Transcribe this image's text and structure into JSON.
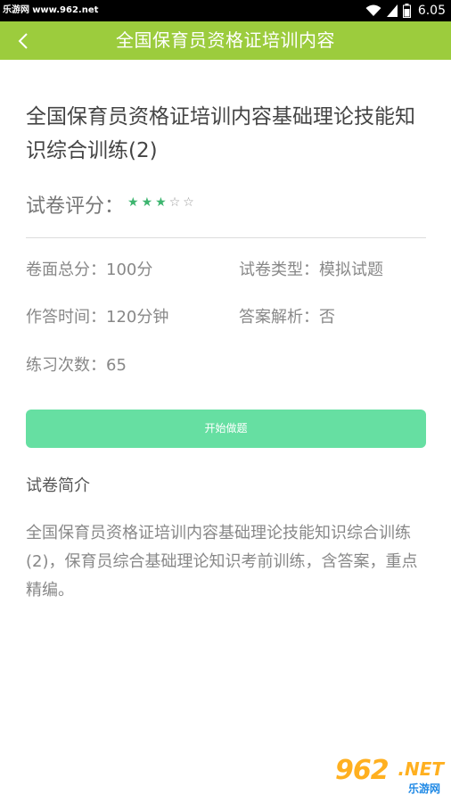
{
  "statusbar": {
    "watermark_site": "乐游网",
    "watermark_url": "www.962.net",
    "time": "6.05"
  },
  "appbar": {
    "title": "全国保育员资格证培训内容"
  },
  "exam": {
    "title": "全国保育员资格证培训内容基础理论技能知识综合训练(2)",
    "rating_label": "试卷评分：",
    "rating": 3,
    "rating_max": 5,
    "info": {
      "total_score": "卷面总分：100分",
      "type": "试卷类型：模拟试题",
      "time": "作答时间：120分钟",
      "analysis": "答案解析：否",
      "practice_count": "练习次数：65"
    },
    "start_button": "开始做题"
  },
  "intro": {
    "heading": "试卷简介",
    "text": "全国保育员资格证培训内容基础理论技能知识综合训练(2)，保育员综合基础理论知识考前训练，含答案，重点精编。"
  },
  "watermark": {
    "logo_num": "962",
    "logo_suffix": ".NET",
    "logo_cn": "乐游网"
  },
  "colors": {
    "appbar": "#9ccc3d",
    "button": "#66dfa2",
    "star": "#3db56f"
  }
}
